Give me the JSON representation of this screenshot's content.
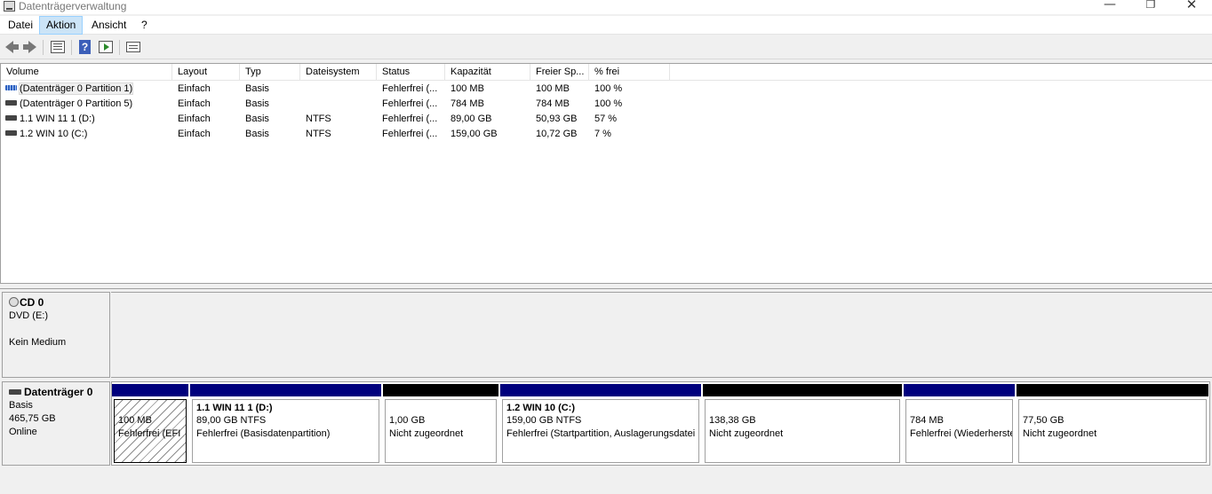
{
  "window": {
    "title": "Datenträgerverwaltung",
    "controls": {
      "minimize": "—",
      "maximize": "❐",
      "close": "✕"
    }
  },
  "menu": {
    "items": [
      "Datei",
      "Aktion",
      "Ansicht",
      "?"
    ],
    "active": "Aktion"
  },
  "toolbar": {
    "icons": [
      "back-arrow-icon",
      "forward-arrow-icon",
      "properties-icon",
      "help-icon",
      "run-icon",
      "checklist-icon"
    ],
    "help_glyph": "?"
  },
  "volume_list": {
    "columns": [
      "Volume",
      "Layout",
      "Typ",
      "Dateisystem",
      "Status",
      "Kapazität",
      "Freier Sp...",
      "% frei"
    ],
    "rows": [
      {
        "volume": "(Datenträger 0 Partition 1)",
        "layout": "Einfach",
        "typ": "Basis",
        "dateisystem": "",
        "status": "Fehlerfrei (...",
        "kapazitaet": "100 MB",
        "frei": "100 MB",
        "prozent": "100 %",
        "icon": "volume-efi-icon"
      },
      {
        "volume": "(Datenträger 0 Partition 5)",
        "layout": "Einfach",
        "typ": "Basis",
        "dateisystem": "",
        "status": "Fehlerfrei (...",
        "kapazitaet": "784 MB",
        "frei": "784 MB",
        "prozent": "100 %",
        "icon": "volume-icon"
      },
      {
        "volume": "1.1 WIN 11 1 (D:)",
        "layout": "Einfach",
        "typ": "Basis",
        "dateisystem": "NTFS",
        "status": "Fehlerfrei (...",
        "kapazitaet": "89,00 GB",
        "frei": "50,93 GB",
        "prozent": "57 %",
        "icon": "volume-icon"
      },
      {
        "volume": "1.2 WIN 10 (C:)",
        "layout": "Einfach",
        "typ": "Basis",
        "dateisystem": "NTFS",
        "status": "Fehlerfrei (...",
        "kapazitaet": "159,00 GB",
        "frei": "10,72 GB",
        "prozent": "7 %",
        "icon": "volume-icon"
      }
    ]
  },
  "disks": {
    "cd": {
      "name": "CD 0",
      "drive": "DVD (E:)",
      "status": "Kein Medium"
    },
    "disk0": {
      "name": "Datenträger 0",
      "type": "Basis",
      "size": "465,75 GB",
      "state": "Online",
      "partitions": [
        {
          "title": "",
          "size": "100 MB",
          "status": "Fehlerfrei (EFI",
          "bar": "blue",
          "hatched": true
        },
        {
          "title": "1.1 WIN 11 1  (D:)",
          "size": "89,00 GB NTFS",
          "status": "Fehlerfrei (Basisdatenpartition)",
          "bar": "blue",
          "hatched": false
        },
        {
          "title": "",
          "size": "1,00 GB",
          "status": "Nicht zugeordnet",
          "bar": "black",
          "hatched": false
        },
        {
          "title": "1.2 WIN 10  (C:)",
          "size": "159,00 GB NTFS",
          "status": "Fehlerfrei (Startpartition, Auslagerungsdatei",
          "bar": "blue",
          "hatched": false
        },
        {
          "title": "",
          "size": "138,38 GB",
          "status": "Nicht zugeordnet",
          "bar": "black",
          "hatched": false
        },
        {
          "title": "",
          "size": "784 MB",
          "status": "Fehlerfrei (Wiederherstellungspartition)",
          "bar": "blue",
          "hatched": false
        },
        {
          "title": "",
          "size": "77,50 GB",
          "status": "Nicht zugeordnet",
          "bar": "black",
          "hatched": false
        }
      ]
    }
  },
  "colors": {
    "primary_partition": "#00007d",
    "unallocated": "#000000",
    "menu_active": "#cce4f7"
  }
}
